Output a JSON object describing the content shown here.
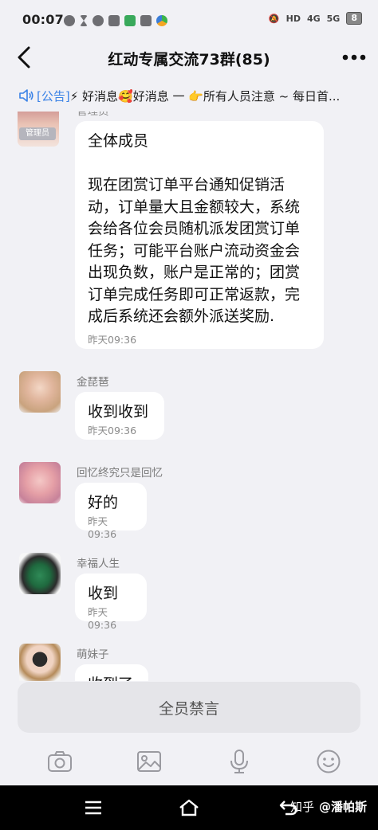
{
  "status": {
    "time": "00:07",
    "network_left": "HD",
    "signal1": "4G",
    "signal2": "5G",
    "battery": "8"
  },
  "header": {
    "title": "红动专属交流73群(85)",
    "back_icon": "chevron-left-icon",
    "more_icon": "more-icon"
  },
  "notice": {
    "tag": "[公告]",
    "text": " ⚡ 好消息🥰好消息 一 👉所有人员注意 ~ 每日首..."
  },
  "messages": [
    {
      "sender": "管理员",
      "badge": "管理员",
      "text": "全体成员\n\n现在团赏订单平台通知促销活动，订单量大且金额较大，系统会给各位会员随机派发团赏订单任务；可能平台账户流动资金会出现负数，账户是正常的；团赏订单完成任务即可正常返款，完成后系统还会额外派送奖励.",
      "time": "昨天09:36"
    },
    {
      "sender": "金琵琶",
      "text": "收到收到",
      "time": "昨天09:36"
    },
    {
      "sender": "回忆终究只是回忆",
      "text": "好的",
      "time": "昨天09:36"
    },
    {
      "sender": "幸福人生",
      "text": "收到",
      "time": "昨天09:36"
    },
    {
      "sender": "萌妹子",
      "text": "收到了",
      "time": ""
    }
  ],
  "footer": {
    "mute_label": "全员禁言",
    "tools": [
      "camera-icon",
      "image-icon",
      "microphone-icon",
      "emoji-icon"
    ]
  },
  "watermark": {
    "site": "知乎",
    "user": "@潘帕斯"
  },
  "colors": {
    "background": "#f1f1f5",
    "bubble": "#ffffff",
    "notice_tag": "#3a82e6",
    "mute_button": "#e5e5e9"
  }
}
